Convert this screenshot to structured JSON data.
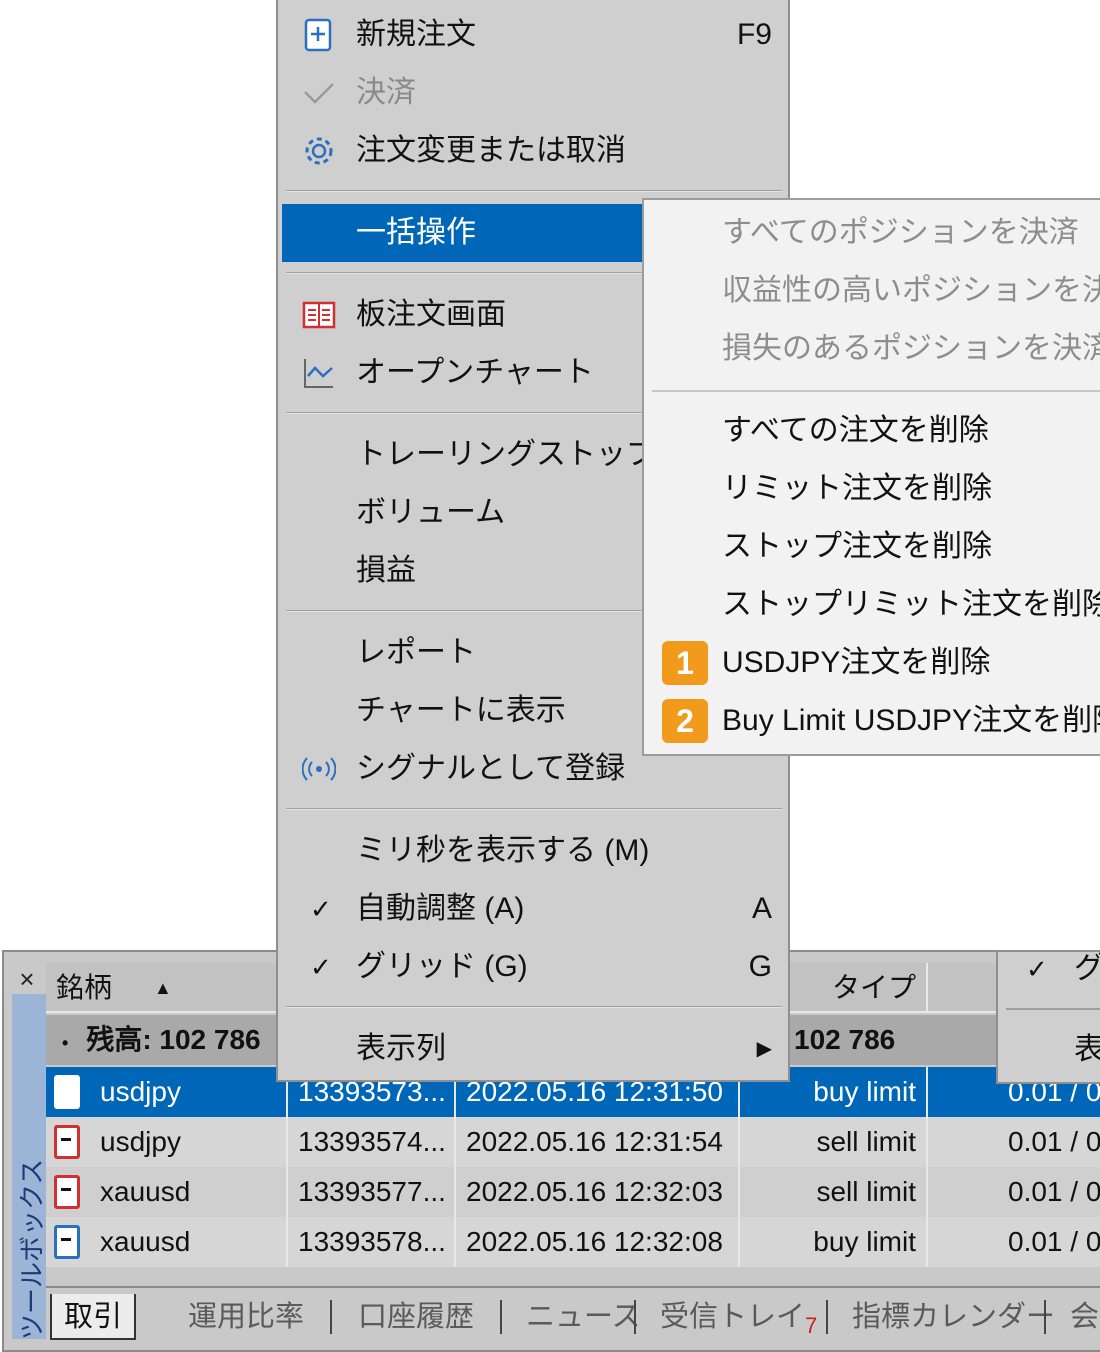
{
  "context_menu": {
    "new_order": {
      "label": "新規注文",
      "shortcut": "F9"
    },
    "close": {
      "label": "決済"
    },
    "modify_or_cancel": {
      "label": "注文変更または取消"
    },
    "bulk_ops": {
      "label": "一括操作"
    },
    "depth_of_market": {
      "label": "板注文画面"
    },
    "open_chart": {
      "label": "オープンチャート"
    },
    "trailing_stop": {
      "label": "トレーリングストップ"
    },
    "volume": {
      "label": "ボリューム"
    },
    "profit": {
      "label": "損益"
    },
    "report": {
      "label": "レポート"
    },
    "show_on_chart": {
      "label": "チャートに表示"
    },
    "register_signal": {
      "label": "シグナルとして登録"
    },
    "show_ms": {
      "label": "ミリ秒を表示する (M)"
    },
    "auto_arrange": {
      "label": "自動調整 (A)",
      "shortcut": "A",
      "checked": true
    },
    "grid": {
      "label": "グリッド (G)",
      "shortcut": "G",
      "checked": true
    },
    "columns": {
      "label": "表示列"
    }
  },
  "submenu": {
    "close_all": "すべてのポジションを決済",
    "close_profitable": "収益性の高いポジションを決済",
    "close_losing": "損失のあるポジションを決済",
    "delete_all_orders": "すべての注文を削除",
    "delete_limit": "リミット注文を削除",
    "delete_stop": "ストップ注文を削除",
    "delete_stop_limit": "ストップリミット注文を削除",
    "delete_usdjpy": {
      "badge": "1",
      "label": "USDJPY注文を削除"
    },
    "delete_buylimit_usdjpy": {
      "badge": "2",
      "label": "Buy Limit USDJPY注文を削除"
    }
  },
  "right_menu_fragment": {
    "check": "✓",
    "item1": "グ",
    "item2": "表"
  },
  "toolbox": {
    "close_glyph": "×",
    "vertical_label": "ツールボックス",
    "header": {
      "symbol": "銘柄",
      "sort_glyph": "▲",
      "type": "タイプ"
    },
    "balance": {
      "label": "残高: 102 786",
      "value": "102 786"
    },
    "rows": [
      {
        "symbol": "usdjpy",
        "ticket": "13393573...",
        "time": "2022.05.16 12:31:50",
        "type": "buy limit",
        "volume": "0.01 / 0",
        "icon_color": "#2a6fc0"
      },
      {
        "symbol": "usdjpy",
        "ticket": "13393574...",
        "time": "2022.05.16 12:31:54",
        "type": "sell limit",
        "volume": "0.01 / 0",
        "icon_color": "#d03030"
      },
      {
        "symbol": "xauusd",
        "ticket": "13393577...",
        "time": "2022.05.16 12:32:03",
        "type": "sell limit",
        "volume": "0.01 / 0",
        "icon_color": "#d03030"
      },
      {
        "symbol": "xauusd",
        "ticket": "13393578...",
        "time": "2022.05.16 12:32:08",
        "type": "buy limit",
        "volume": "0.01 / 0",
        "icon_color": "#2a6fc0"
      }
    ],
    "tabs": [
      "取引",
      "運用比率",
      "口座履歴",
      "ニュース",
      "受信トレイ",
      "指標カレンダー",
      "会"
    ],
    "inbox_count": "7"
  },
  "colors": {
    "highlight": "#0067b8",
    "badge": "#f29a1c",
    "menu_bg": "#cfcfcf",
    "submenu_bg": "#f2f2f2"
  }
}
